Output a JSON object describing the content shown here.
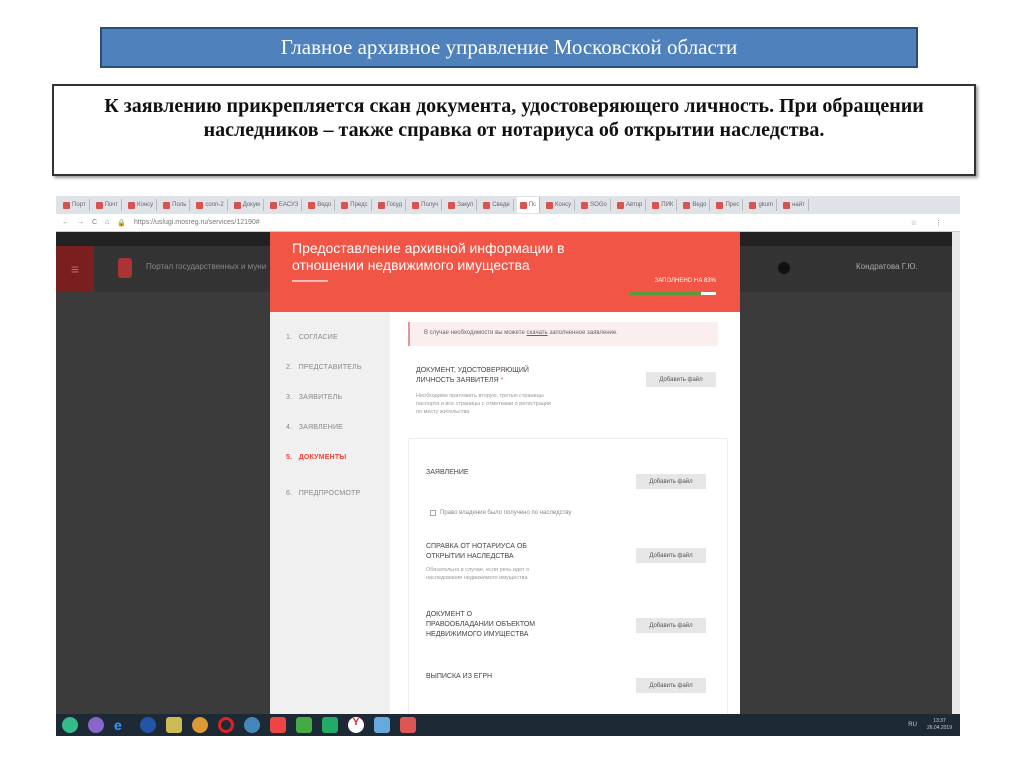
{
  "slide": {
    "title": "Главное архивное управление Московской области",
    "note": "К заявлению прикрепляется скан документа, удостоверяющего личность. При обращении наследников – также справка от нотариуса об открытии наследства."
  },
  "browser": {
    "tabs": [
      "Порт",
      "Почт",
      "Консу",
      "Поль",
      "conn-2",
      "Докум",
      "ЕАСУЗ",
      "Ведо",
      "Предс",
      "Госуд",
      "Получ",
      "Закуп",
      "Сведе",
      "Пс",
      "Консу",
      "SOGo",
      "Автор",
      "ПИК",
      "Ведо",
      "Прес",
      "gkum",
      "найт"
    ],
    "url": "https://uslugi.mosreg.ru/services/12190#"
  },
  "portal": {
    "name": "Портал государственных и муниципальных услуг",
    "user": "Кондратова Г.Ю."
  },
  "modal": {
    "title": "Предоставление архивной информации в отношении недвижимого имущества",
    "progress_label": "ЗАПОЛНЕНО НА 83%",
    "progress": 0.83
  },
  "steps": [
    {
      "n": "1.",
      "label": "СОГЛАСИЕ"
    },
    {
      "n": "2.",
      "label": "ПРЕДСТАВИТЕЛЬ"
    },
    {
      "n": "3.",
      "label": "ЗАЯВИТЕЛЬ"
    },
    {
      "n": "4.",
      "label": "ЗАЯВЛЕНИЕ"
    },
    {
      "n": "5.",
      "label": "ДОКУМЕНТЫ"
    },
    {
      "n": "6.",
      "label": "ПРЕДПРОСМОТР"
    }
  ],
  "notice": {
    "before": "В случае необходимости вы можете ",
    "link": "скачать",
    "after": " заполненное заявление."
  },
  "docs": [
    {
      "title": "ДОКУМЕНТ, УДОСТОВЕРЯЮЩИЙ ЛИЧНОСТЬ ЗАЯВИТЕЛЯ",
      "required": "*",
      "hint": "Необходимо приложить вторую, третью страницы паспорта и все страницы с отметками о регистрации по месту жительства",
      "button": "Добавить файл"
    },
    {
      "title": "ЗАЯВЛЕНИЕ",
      "button": "Добавить файл"
    },
    {
      "title": "СПРАВКА ОТ НОТАРИУСА ОБ ОТКРЫТИИ НАСЛЕДСТВА",
      "hint": "Обязательно в случае, если речь идет о наследовании недвижимого имущества",
      "button": "Добавить файл"
    },
    {
      "title": "ДОКУМЕНТ О ПРАВООБЛАДАНИИ ОБЪЕКТОМ НЕДВИЖИМОГО ИМУЩЕСТВА",
      "button": "Добавить файл"
    },
    {
      "title": "ВЫПИСКА ИЗ ЕГРН",
      "button": "Добавить файл"
    }
  ],
  "checkbox": {
    "label": "Право владения было получено по наследству",
    "checked": false
  },
  "taskbar": {
    "lang": "RU",
    "time": "13:37",
    "date": "26.04.2019"
  }
}
